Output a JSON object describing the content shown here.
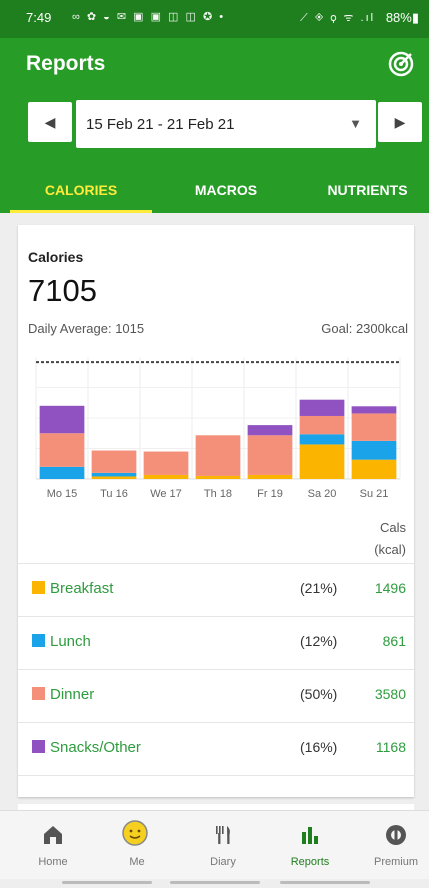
{
  "status_bar": {
    "time": "7:49",
    "icons": "∞ ✿ ◒ ✉ ▣ ▣ ◫ ◫ ✪ •",
    "signals": "⟋ ◈ ⚲ ᯤ .ıl",
    "battery": "88%▮"
  },
  "header": {
    "title": "Reports",
    "goal_icon": "target-icon"
  },
  "date_range": {
    "label": "15 Feb 21 - 21 Feb 21",
    "prev": "◀",
    "next": "▶",
    "caret": "▼"
  },
  "tabs": [
    {
      "label": "CALORIES",
      "active": true
    },
    {
      "label": "MACROS"
    },
    {
      "label": "NUTRIENTS"
    }
  ],
  "summary": {
    "title": "Calories",
    "total": "7105",
    "daily_average": "Daily Average: 1015",
    "goal": "Goal: 2300kcal"
  },
  "colors": {
    "breakfast": "#fbb500",
    "lunch": "#1aa3e8",
    "dinner": "#f4907a",
    "snacks": "#9051c1",
    "brand": "#279c27",
    "accent": "#ffeb3b"
  },
  "chart_data": {
    "type": "bar",
    "stacked": true,
    "categories": [
      "Mo 15",
      "Tu 16",
      "We 17",
      "Th 18",
      "Fr 19",
      "Sa 20",
      "Su 21"
    ],
    "series": [
      {
        "name": "Breakfast",
        "color": "#fbb500",
        "values": [
          0,
          50,
          80,
          60,
          80,
          680,
          380
        ]
      },
      {
        "name": "Lunch",
        "color": "#1aa3e8",
        "values": [
          240,
          70,
          0,
          0,
          0,
          200,
          370
        ]
      },
      {
        "name": "Dinner",
        "color": "#f4907a",
        "values": [
          660,
          440,
          460,
          800,
          780,
          360,
          540
        ]
      },
      {
        "name": "Snacks/Other",
        "color": "#9051c1",
        "values": [
          540,
          0,
          0,
          0,
          200,
          320,
          140
        ]
      }
    ],
    "goal": 2300,
    "ylim": [
      0,
      2400
    ]
  },
  "cals_header": {
    "line1": "Cals",
    "line2": "(kcal)"
  },
  "meals": [
    {
      "name": "Breakfast",
      "pct": "(21%)",
      "kcal": "1496",
      "color": "#fbb500"
    },
    {
      "name": "Lunch",
      "pct": "(12%)",
      "kcal": "861",
      "color": "#1aa3e8"
    },
    {
      "name": "Dinner",
      "pct": "(50%)",
      "kcal": "3580",
      "color": "#f4907a"
    },
    {
      "name": "Snacks/Other",
      "pct": "(16%)",
      "kcal": "1168",
      "color": "#9051c1"
    }
  ],
  "nav": [
    {
      "label": "Home",
      "icon": "home-icon"
    },
    {
      "label": "Me",
      "icon": "avatar-icon"
    },
    {
      "label": "Diary",
      "icon": "fork-knife-icon"
    },
    {
      "label": "Reports",
      "icon": "bar-chart-icon",
      "active": true
    },
    {
      "label": "Premium",
      "icon": "premium-icon"
    }
  ]
}
